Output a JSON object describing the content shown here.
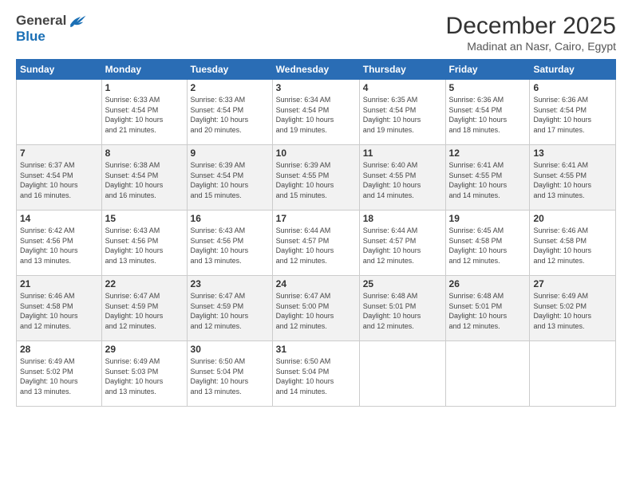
{
  "header": {
    "logo_general": "General",
    "logo_blue": "Blue",
    "month": "December 2025",
    "location": "Madinat an Nasr, Cairo, Egypt"
  },
  "weekdays": [
    "Sunday",
    "Monday",
    "Tuesday",
    "Wednesday",
    "Thursday",
    "Friday",
    "Saturday"
  ],
  "weeks": [
    [
      {
        "day": "",
        "info": ""
      },
      {
        "day": "1",
        "info": "Sunrise: 6:33 AM\nSunset: 4:54 PM\nDaylight: 10 hours\nand 21 minutes."
      },
      {
        "day": "2",
        "info": "Sunrise: 6:33 AM\nSunset: 4:54 PM\nDaylight: 10 hours\nand 20 minutes."
      },
      {
        "day": "3",
        "info": "Sunrise: 6:34 AM\nSunset: 4:54 PM\nDaylight: 10 hours\nand 19 minutes."
      },
      {
        "day": "4",
        "info": "Sunrise: 6:35 AM\nSunset: 4:54 PM\nDaylight: 10 hours\nand 19 minutes."
      },
      {
        "day": "5",
        "info": "Sunrise: 6:36 AM\nSunset: 4:54 PM\nDaylight: 10 hours\nand 18 minutes."
      },
      {
        "day": "6",
        "info": "Sunrise: 6:36 AM\nSunset: 4:54 PM\nDaylight: 10 hours\nand 17 minutes."
      }
    ],
    [
      {
        "day": "7",
        "info": "Sunrise: 6:37 AM\nSunset: 4:54 PM\nDaylight: 10 hours\nand 16 minutes."
      },
      {
        "day": "8",
        "info": "Sunrise: 6:38 AM\nSunset: 4:54 PM\nDaylight: 10 hours\nand 16 minutes."
      },
      {
        "day": "9",
        "info": "Sunrise: 6:39 AM\nSunset: 4:54 PM\nDaylight: 10 hours\nand 15 minutes."
      },
      {
        "day": "10",
        "info": "Sunrise: 6:39 AM\nSunset: 4:55 PM\nDaylight: 10 hours\nand 15 minutes."
      },
      {
        "day": "11",
        "info": "Sunrise: 6:40 AM\nSunset: 4:55 PM\nDaylight: 10 hours\nand 14 minutes."
      },
      {
        "day": "12",
        "info": "Sunrise: 6:41 AM\nSunset: 4:55 PM\nDaylight: 10 hours\nand 14 minutes."
      },
      {
        "day": "13",
        "info": "Sunrise: 6:41 AM\nSunset: 4:55 PM\nDaylight: 10 hours\nand 13 minutes."
      }
    ],
    [
      {
        "day": "14",
        "info": "Sunrise: 6:42 AM\nSunset: 4:56 PM\nDaylight: 10 hours\nand 13 minutes."
      },
      {
        "day": "15",
        "info": "Sunrise: 6:43 AM\nSunset: 4:56 PM\nDaylight: 10 hours\nand 13 minutes."
      },
      {
        "day": "16",
        "info": "Sunrise: 6:43 AM\nSunset: 4:56 PM\nDaylight: 10 hours\nand 13 minutes."
      },
      {
        "day": "17",
        "info": "Sunrise: 6:44 AM\nSunset: 4:57 PM\nDaylight: 10 hours\nand 12 minutes."
      },
      {
        "day": "18",
        "info": "Sunrise: 6:44 AM\nSunset: 4:57 PM\nDaylight: 10 hours\nand 12 minutes."
      },
      {
        "day": "19",
        "info": "Sunrise: 6:45 AM\nSunset: 4:58 PM\nDaylight: 10 hours\nand 12 minutes."
      },
      {
        "day": "20",
        "info": "Sunrise: 6:46 AM\nSunset: 4:58 PM\nDaylight: 10 hours\nand 12 minutes."
      }
    ],
    [
      {
        "day": "21",
        "info": "Sunrise: 6:46 AM\nSunset: 4:58 PM\nDaylight: 10 hours\nand 12 minutes."
      },
      {
        "day": "22",
        "info": "Sunrise: 6:47 AM\nSunset: 4:59 PM\nDaylight: 10 hours\nand 12 minutes."
      },
      {
        "day": "23",
        "info": "Sunrise: 6:47 AM\nSunset: 4:59 PM\nDaylight: 10 hours\nand 12 minutes."
      },
      {
        "day": "24",
        "info": "Sunrise: 6:47 AM\nSunset: 5:00 PM\nDaylight: 10 hours\nand 12 minutes."
      },
      {
        "day": "25",
        "info": "Sunrise: 6:48 AM\nSunset: 5:01 PM\nDaylight: 10 hours\nand 12 minutes."
      },
      {
        "day": "26",
        "info": "Sunrise: 6:48 AM\nSunset: 5:01 PM\nDaylight: 10 hours\nand 12 minutes."
      },
      {
        "day": "27",
        "info": "Sunrise: 6:49 AM\nSunset: 5:02 PM\nDaylight: 10 hours\nand 13 minutes."
      }
    ],
    [
      {
        "day": "28",
        "info": "Sunrise: 6:49 AM\nSunset: 5:02 PM\nDaylight: 10 hours\nand 13 minutes."
      },
      {
        "day": "29",
        "info": "Sunrise: 6:49 AM\nSunset: 5:03 PM\nDaylight: 10 hours\nand 13 minutes."
      },
      {
        "day": "30",
        "info": "Sunrise: 6:50 AM\nSunset: 5:04 PM\nDaylight: 10 hours\nand 13 minutes."
      },
      {
        "day": "31",
        "info": "Sunrise: 6:50 AM\nSunset: 5:04 PM\nDaylight: 10 hours\nand 14 minutes."
      },
      {
        "day": "",
        "info": ""
      },
      {
        "day": "",
        "info": ""
      },
      {
        "day": "",
        "info": ""
      }
    ]
  ]
}
